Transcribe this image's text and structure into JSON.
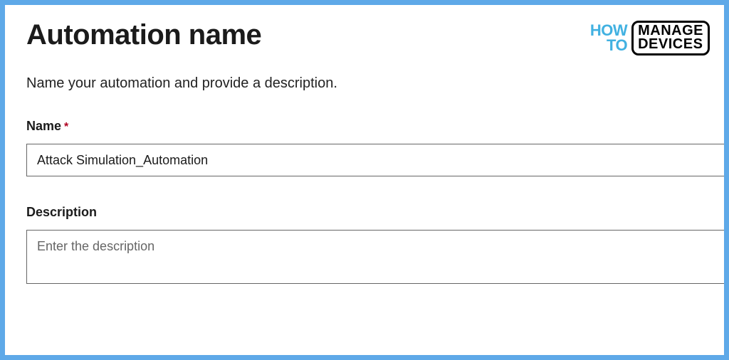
{
  "page": {
    "title": "Automation name",
    "subtitle": "Name your automation and provide a description."
  },
  "logo": {
    "how": "HOW",
    "to": "TO",
    "manage": "MANAGE",
    "devices": "DEVICES"
  },
  "form": {
    "name_label": "Name",
    "name_required": "*",
    "name_value": "Attack Simulation_Automation",
    "description_label": "Description",
    "description_value": "",
    "description_placeholder": "Enter the description"
  }
}
